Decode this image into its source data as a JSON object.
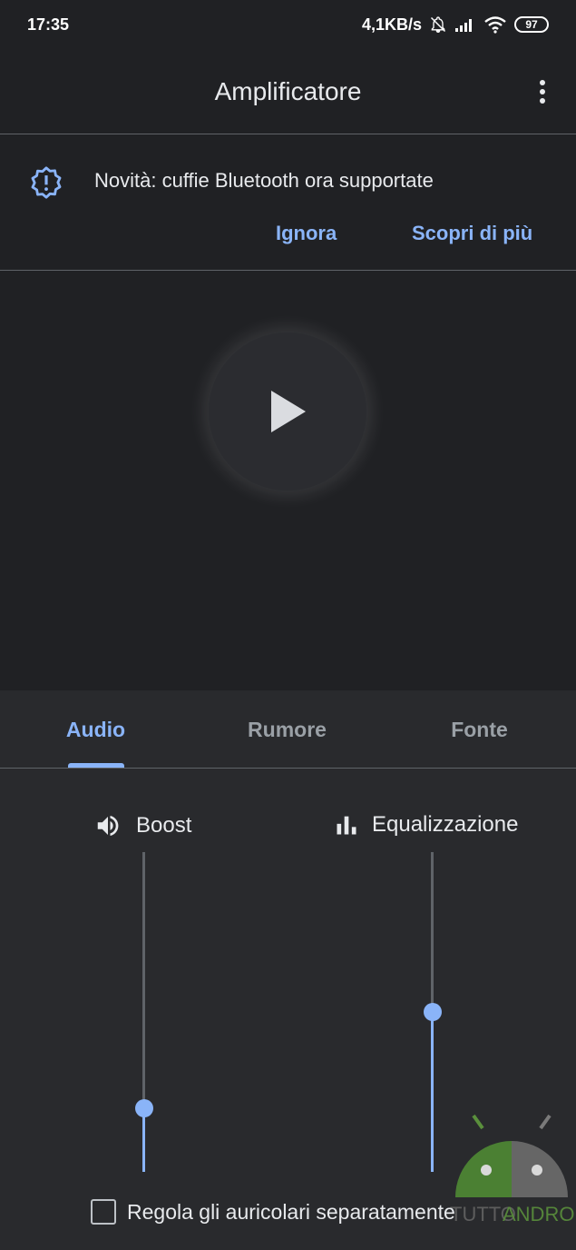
{
  "status_bar": {
    "time": "17:35",
    "network_speed": "4,1KB/s",
    "battery": "97",
    "icons": [
      "bell-off-icon",
      "signal-icon",
      "wifi-icon",
      "battery-icon"
    ]
  },
  "app_bar": {
    "title": "Amplificatore",
    "menu_icon": "more-vert-icon"
  },
  "banner": {
    "icon": "new-releases-icon",
    "text": "Novità: cuffie Bluetooth ora supportate",
    "ignore_label": "Ignora",
    "learn_more_label": "Scopri di più"
  },
  "player": {
    "play_icon": "play-icon"
  },
  "tabs": [
    {
      "label": "Audio",
      "active": true
    },
    {
      "label": "Rumore",
      "active": false
    },
    {
      "label": "Fonte",
      "active": false
    }
  ],
  "audio": {
    "boost": {
      "label": "Boost",
      "icon": "volume-icon",
      "level": 0.2
    },
    "equalization": {
      "label": "Equalizzazione",
      "icon": "equalizer-icon",
      "level": 0.5
    },
    "separate_checkbox": {
      "label": "Regola gli auricolari separatamente",
      "checked": false
    }
  },
  "colors": {
    "accent": "#8ab4f8",
    "background": "#202124",
    "panel": "#292a2d"
  },
  "watermark": {
    "text": "TUTTOANDROID"
  }
}
